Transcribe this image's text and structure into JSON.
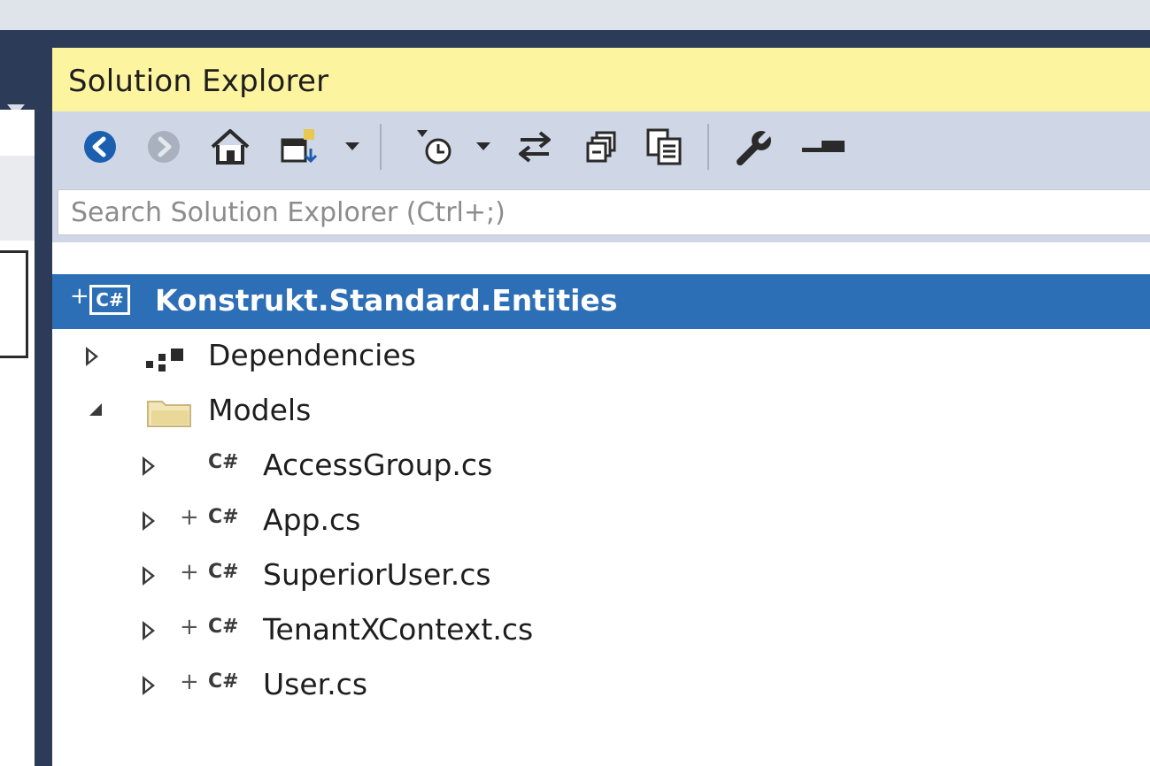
{
  "panel": {
    "title": "Solution Explorer"
  },
  "toolbar": {
    "buttons": [
      {
        "icon": "back-arrow-icon"
      },
      {
        "icon": "forward-arrow-icon"
      },
      {
        "icon": "home-icon"
      },
      {
        "icon": "switch-views-icon"
      },
      {
        "icon": "pending-changes-filter-icon"
      },
      {
        "icon": "sync-with-active-document-icon"
      },
      {
        "icon": "collapse-all-icon"
      },
      {
        "icon": "show-all-files-icon"
      },
      {
        "icon": "properties-wrench-icon"
      },
      {
        "icon": "preview-selected-items-icon"
      }
    ]
  },
  "search": {
    "placeholder": "Search Solution Explorer (Ctrl+;)",
    "value": ""
  },
  "tree": {
    "project": {
      "label": "Konstrukt.Standard.Entities",
      "icon_text": "C#",
      "selected": true
    },
    "dependencies": {
      "label": "Dependencies",
      "expanded": false
    },
    "models": {
      "label": "Models",
      "expanded": true
    },
    "files": [
      {
        "label": "AccessGroup.cs",
        "icon_text": "C#",
        "pending_add": false
      },
      {
        "label": "App.cs",
        "icon_text": "C#",
        "pending_add": true
      },
      {
        "label": "SuperiorUser.cs",
        "icon_text": "C#",
        "pending_add": true
      },
      {
        "label": "TenantXContext.cs",
        "icon_text": "C#",
        "pending_add": true
      },
      {
        "label": "User.cs",
        "icon_text": "C#",
        "pending_add": true
      }
    ],
    "plus_glyph": "+"
  },
  "colors": {
    "title_bar": "#fdf4a0",
    "toolbar": "#cfd6e5",
    "selection": "#2d6fb6",
    "frame": "#2b3b58"
  }
}
